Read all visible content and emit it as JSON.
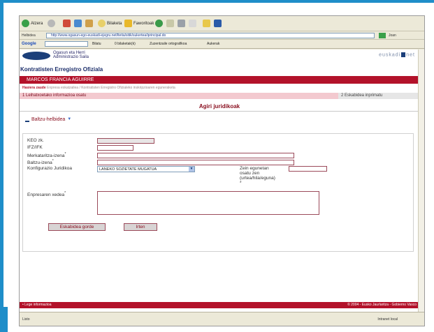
{
  "browser": {
    "back_label": "Atzera",
    "search_label": "Bilaketa",
    "favorites_label": "Faworitoak",
    "address_label": "Helbidea",
    "url": "http://www.ogasun-ego-euskadi-ejegru.net/ltetia/sitik/sukertea/iprincipal.do",
    "go_label": "Joan",
    "google_label": "Google",
    "bilatu_label": "Bilatu",
    "bilaketak_label": "0 bilaketak(k)",
    "zuzentzailea_label": "Zuzentzaile ortografikoa",
    "aukerak_label": "Aukerak",
    "status_left": "Listo",
    "status_right": "Intranet local"
  },
  "header": {
    "org_line1": "Ogasun eta Herri",
    "org_line2": "Administrazio Saila",
    "euskadi_pre": "euskadi",
    "euskadi_post": "net"
  },
  "app": {
    "title": "Kontratisten Erregistro Ofiziala",
    "user_name": "MARCOS FRANCIA AGUIRRE",
    "breadcrumb_home": "Hasiera zaude",
    "breadcrumb_rest": "Enpresa eskatzailea / Kontratisten Erregistro Ofizialeko inskripzioaren eguneraketa",
    "step1": "1 Leihatxoetako informazioa osatu",
    "step2": "2 Eskabidea inprimatu",
    "section_title": "Agiri juridikoak",
    "subsection_title": "Baltzu-helbidea"
  },
  "form": {
    "keo_label": "KEO zk.",
    "ifz_label": "IFZ/IFK",
    "merkataritza_label": "Merkataritza-izena",
    "baltzu_label": "Baltzu-izena",
    "konfigurazio_label": "Konfigurazio Juridikoa",
    "konfigurazio_value": "LANEKO SOZIETATE MUGATUA",
    "data_label_1": "Zein egunetan",
    "data_label_2": "osatu zen",
    "data_label_3": "(urtea/hila/eguna)",
    "required_mark": "*",
    "xedea_label": "Enpresaren xedea",
    "save_label": "Eskabidea gorde",
    "exit_label": "Irten"
  },
  "footer": {
    "left": "• Lege informazioa",
    "right": "© 2004 - Eusko Jaurlaritza - Gobierno Vasco"
  },
  "colors": {
    "brand_red": "#b3122a",
    "brand_blue": "#1b3f7a",
    "accent_blue": "#1f8ec9"
  }
}
